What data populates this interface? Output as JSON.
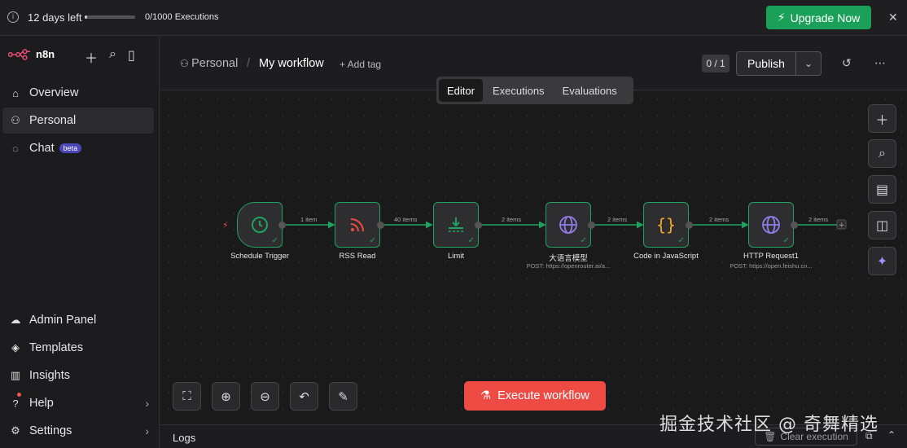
{
  "trial": {
    "days_left": "12 days left",
    "executions": "0/1000 Executions",
    "progress": 0.05
  },
  "upgrade": {
    "label": "Upgrade Now"
  },
  "sidebar": {
    "brand": "n8n",
    "items": [
      {
        "label": "Overview",
        "icon": "home-icon"
      },
      {
        "label": "Personal",
        "icon": "user-icon"
      },
      {
        "label": "Chat",
        "icon": "chat-icon",
        "badge": "beta"
      }
    ],
    "bottom_items": [
      {
        "label": "Admin Panel",
        "icon": "cloud-icon"
      },
      {
        "label": "Templates",
        "icon": "box-icon"
      },
      {
        "label": "Insights",
        "icon": "chart-icon"
      },
      {
        "label": "Help",
        "icon": "help-icon"
      },
      {
        "label": "Settings",
        "icon": "gear-icon"
      }
    ]
  },
  "header": {
    "project": "Personal",
    "workflow": "My workflow",
    "add_tag": "+ Add tag",
    "publish_count": "0 / 1",
    "publish": "Publish"
  },
  "tabs": [
    "Editor",
    "Executions",
    "Evaluations"
  ],
  "nodes": [
    {
      "label": "Schedule Trigger",
      "sub": ""
    },
    {
      "label": "RSS Read",
      "sub": ""
    },
    {
      "label": "Limit",
      "sub": ""
    },
    {
      "label": "大语言模型",
      "sub": "POST: https://openrouter.ai/a..."
    },
    {
      "label": "Code in JavaScript",
      "sub": ""
    },
    {
      "label": "HTTP Request1",
      "sub": "POST: https://open.feishu.cn..."
    }
  ],
  "edges": [
    "1 item",
    "40 items",
    "2 items",
    "2 items",
    "2 items",
    "2 items"
  ],
  "execute": {
    "label": "Execute workflow"
  },
  "logs": {
    "title": "Logs",
    "clear": "Clear execution"
  },
  "watermark": "掘金技术社区 @ 奇舞精选"
}
